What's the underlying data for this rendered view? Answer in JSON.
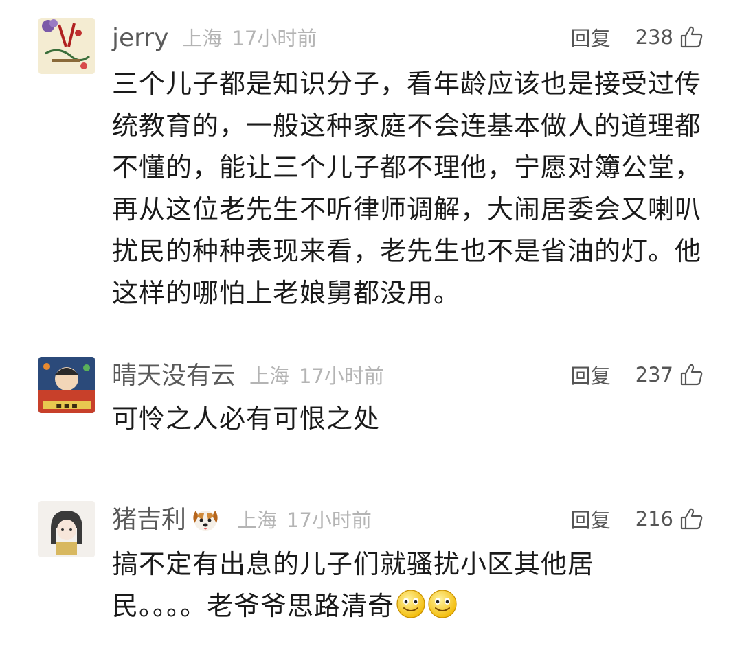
{
  "comments": [
    {
      "username": "jerry",
      "location": "上海",
      "time": "17小时前",
      "reply_label": "回复",
      "likes": "238",
      "text": "三个儿子都是知识分子，看年龄应该也是接受过传统教育的，一般这种家庭不会连基本做人的道理都不懂的，能让三个儿子都不理他，宁愿对簿公堂，再从这位老先生不听律师调解，大闹居委会又喇叭扰民的种种表现来看，老先生也不是省油的灯。他这样的哪怕上老娘舅都没用。"
    },
    {
      "username": "晴天没有云",
      "location": "上海",
      "time": "17小时前",
      "reply_label": "回复",
      "likes": "237",
      "text": "可怜之人必有可恨之处"
    },
    {
      "username": "猪吉利",
      "username_emoji": "dog-face-icon",
      "location": "上海",
      "time": "17小时前",
      "reply_label": "回复",
      "likes": "216",
      "text": "搞不定有出息的儿子们就骚扰小区其他居民。。。。老爷爷思路清奇",
      "trailing_emojis": [
        "smiley-icon",
        "smiley-icon"
      ]
    }
  ],
  "colors": {
    "username": "#5a5a5a",
    "meta": "#b4b4b4",
    "body_text": "#1a1a1a",
    "action": "#555555"
  }
}
